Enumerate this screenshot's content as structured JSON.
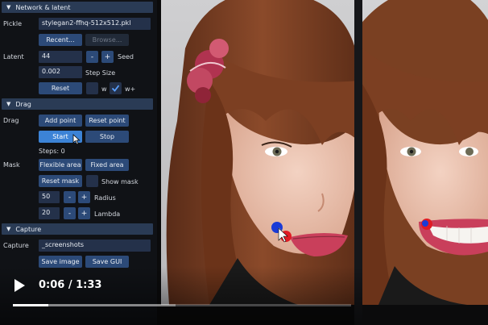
{
  "panel": {
    "sections": {
      "network": "Network & latent",
      "drag": "Drag",
      "capture": "Capture"
    },
    "pickle_label": "Pickle",
    "pickle_value": "stylegan2-ffhq-512x512.pkl",
    "recent_label": "Recent...",
    "browse_label": "Browse...",
    "latent_label": "Latent",
    "seed_value": "44",
    "seed_label": "Seed",
    "step_value": "0.002",
    "step_label": "Step Size",
    "reset_label": "Reset",
    "w_label": "w",
    "wplus_label": "w+",
    "drag_label": "Drag",
    "add_point": "Add point",
    "reset_point": "Reset point",
    "start": "Start",
    "stop": "Stop",
    "steps": "Steps: 0",
    "mask_label": "Mask",
    "flexible_area": "Flexible area",
    "fixed_area": "Fixed area",
    "reset_mask": "Reset mask",
    "show_mask": "Show mask",
    "radius_value": "50",
    "radius_label": "Radius",
    "lambda_value": "20",
    "lambda_label": "Lambda",
    "capture_label": "Capture",
    "capture_value": "_screenshots",
    "save_image": "Save image",
    "save_gui": "Save GUI",
    "minus": "-",
    "plus": "+"
  },
  "video": {
    "time": "0:06 / 1:33",
    "progress_played": 0.105,
    "progress_loaded": 0.48
  },
  "colors": {
    "accent": "#3c83d6",
    "header": "#2a3b55",
    "handle_point": "#e01b24",
    "target_point": "#1a3bd6"
  }
}
